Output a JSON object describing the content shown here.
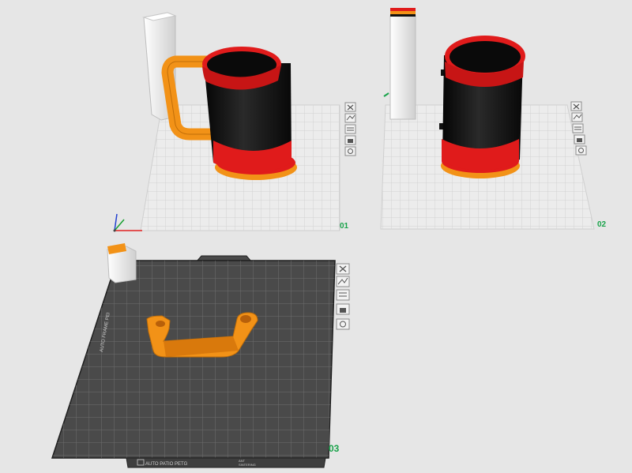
{
  "plates": [
    {
      "label": "01"
    },
    {
      "label": "02"
    },
    {
      "label": "03"
    }
  ],
  "plate3_bed": {
    "left_edge_text": "AUTO FRAME PEI",
    "bottom_text": "AUTO PATIO PETG",
    "bottom_small_text_1": "ANT",
    "bottom_small_text_2": "SINTERING"
  },
  "plate_tools": [
    "close-icon",
    "arrange-icon",
    "layers-icon",
    "lock-icon",
    "settings-icon"
  ],
  "colors": {
    "background": "#e6e6e6",
    "light_bed": "#ececec",
    "dark_bed": "#4a4a4a",
    "mug_body": "#111111",
    "mug_rim": "#e01b1b",
    "handle": "#f29217",
    "wipe_tower": "#eeeeee",
    "label": "#19a34a"
  }
}
